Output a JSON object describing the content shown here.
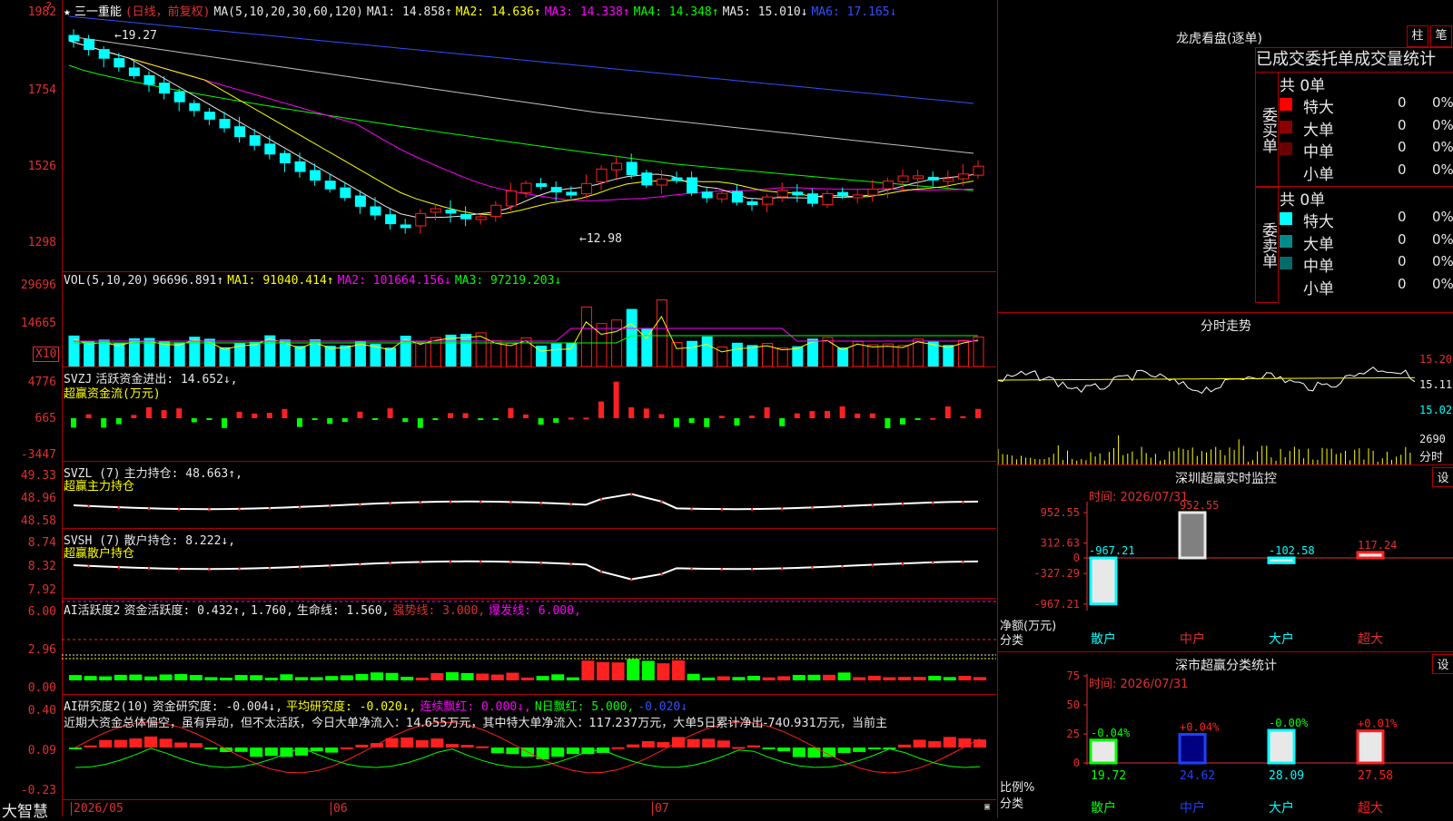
{
  "stock_name": "三一重能",
  "chart_mode": "(日线，前复权)",
  "ma_header": {
    "params": "MA(5,10,20,30,60,120)",
    "ma1": "MA1: 14.858↑",
    "ma2": "MA2: 14.636↑",
    "ma3": "MA3: 14.338↑",
    "ma4": "MA4: 14.348↑",
    "ma5": "MA5: 15.010↓",
    "ma6": "MA6: 17.165↓"
  },
  "price_axis": [
    "1982",
    "1754",
    "1526",
    "1298"
  ],
  "price_high_label": "←19.27",
  "price_low_label": "←12.98",
  "vol_header": {
    "params": "VOL(5,10,20)",
    "value": "96696.891↑",
    "ma1": "MA1: 91040.414↑",
    "ma2": "MA2: 101664.156↓",
    "ma3": "MA3: 97219.203↓"
  },
  "vol_axis": [
    "29696",
    "14665"
  ],
  "vol_unit": "X10",
  "svzj_header": {
    "name": "SVZJ",
    "label": "活跃资金进出: 14.652↓,",
    "sub": "超赢资金流(万元)"
  },
  "svzj_axis": [
    "4776",
    "665",
    "-3447"
  ],
  "svzl_header": {
    "name": "SVZL (7)",
    "label": "主力持仓: 48.663↑,",
    "sub": "超赢主力持仓"
  },
  "svzl_axis": [
    "49.33",
    "48.96",
    "48.58"
  ],
  "svsh_header": {
    "name": "SVSH (7)",
    "label": "散户持仓: 8.222↓,",
    "sub": "超赢散户持仓"
  },
  "svsh_axis": [
    "8.74",
    "8.32",
    "7.92"
  ],
  "ai_act_header": {
    "name": "AI活跃度2",
    "part1": "资金活跃度: 0.432↑,",
    "part2": "1.760,",
    "part3": "生命线: 1.560,",
    "part4": "强势线: 3.000,",
    "part5": "爆发线: 6.000,"
  },
  "ai_act_axis": [
    "6.00",
    "2.96",
    "0.00"
  ],
  "ai_res_header": {
    "name": "AI研究度2(10)",
    "part1": "资金研究度: -0.004↓,",
    "part2": "平均研究度: -0.020↓,",
    "part3": "连续飘红: 0.000↓,",
    "part4": "N日飘红: 5.000,",
    "part5": "-0.020↓"
  },
  "ai_res_text": "近期大资金总体偏空，虽有异动，但不太活跃，今日大单净流入：14.655万元，其中特大单净流入：117.237万元，大单5日累计净出-740.931万元，当前主",
  "ai_res_axis": [
    "0.40",
    "0.09",
    "-0.23"
  ],
  "date_axis": [
    "2026/05",
    "06",
    "07"
  ],
  "brand": "大智慧",
  "dragon": {
    "title": "龙虎看盘(逐单)",
    "btn1": "柱",
    "btn2": "笔",
    "tabs": "已成交委托单成交量统计",
    "buy_label": "委买单",
    "sell_label": "委卖单",
    "buy_total": "共 0单",
    "sell_total": "共 0单",
    "buy_rows": [
      {
        "name": "特大",
        "count": "0",
        "pct": "0%",
        "color": "#ff0000"
      },
      {
        "name": "大单",
        "count": "0",
        "pct": "0%",
        "color": "#8b0000"
      },
      {
        "name": "中单",
        "count": "0",
        "pct": "0%",
        "color": "#6b0000"
      },
      {
        "name": "小单",
        "count": "0",
        "pct": "0%",
        "color": "#000000"
      }
    ],
    "sell_rows": [
      {
        "name": "特大",
        "count": "0",
        "pct": "0%",
        "color": "#00ffff"
      },
      {
        "name": "大单",
        "count": "0",
        "pct": "0%",
        "color": "#008b8b"
      },
      {
        "name": "中单",
        "count": "0",
        "pct": "0%",
        "color": "#006b6b"
      },
      {
        "name": "小单",
        "count": "0",
        "pct": "0%",
        "color": "#000000"
      }
    ]
  },
  "intraday": {
    "title": "分时走势",
    "axis": [
      "15.20",
      "15.11",
      "15.02"
    ],
    "vol_top": "2690",
    "vol_unit": "分时"
  },
  "monitor": {
    "title": "深圳超赢实时监控",
    "btn": "设",
    "time": "时间: 2026/07/31",
    "axis": [
      "952.55",
      "312.63",
      "0",
      "-327.29",
      "-967.21"
    ],
    "axis_label": "净额(万元)",
    "cat_label": "分类",
    "categories": [
      "散户",
      "中户",
      "大户",
      "超大"
    ],
    "values": [
      "-967.21",
      "952.55",
      "-102.58",
      "117.24"
    ]
  },
  "classify": {
    "title": "深市超赢分类统计",
    "btn": "设",
    "time": "时间: 2026/07/31",
    "axis": [
      "75",
      "50",
      "25",
      "0"
    ],
    "axis_label": "比例%",
    "cat_label": "分类",
    "categories": [
      "散户",
      "中户",
      "大户",
      "超大"
    ],
    "changes": [
      "-0.04%",
      "+0.04%",
      "-0.00%",
      "+0.01%"
    ],
    "values": [
      "19.72",
      "24.62",
      "28.09",
      "27.58"
    ]
  },
  "colors": {
    "up": "#ff2020",
    "down": "#00ffff",
    "green": "#00ff00",
    "grid": "#b00000",
    "yellow": "#ffff00",
    "magenta": "#ff00ff"
  }
}
